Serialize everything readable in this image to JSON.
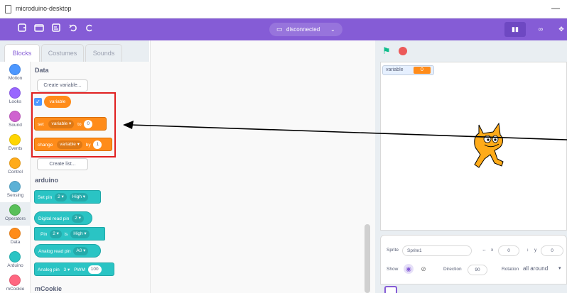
{
  "window": {
    "title": "microduino-desktop",
    "minimize": "—"
  },
  "menubar": {
    "connection_label": "disconnected",
    "mode_buttons": [
      "▮▮",
      "∞",
      "✥"
    ]
  },
  "tabs": [
    "Blocks",
    "Costumes",
    "Sounds"
  ],
  "categories": [
    {
      "label": "Motion",
      "color": "#4c97ff"
    },
    {
      "label": "Looks",
      "color": "#9966ff"
    },
    {
      "label": "Sound",
      "color": "#cf63cf"
    },
    {
      "label": "Events",
      "color": "#ffd500"
    },
    {
      "label": "Control",
      "color": "#ffab19"
    },
    {
      "label": "Sensing",
      "color": "#5cb1d6"
    },
    {
      "label": "Operators",
      "color": "#59c059"
    },
    {
      "label": "Data",
      "color": "#ff8c1a"
    },
    {
      "label": "Arduino",
      "color": "#2ac4c4"
    },
    {
      "label": "mCookie",
      "color": "#ff6680"
    }
  ],
  "palette": {
    "data_title": "Data",
    "create_variable": "Create variable...",
    "variable_reporter": "variable",
    "set_block": {
      "op": "set",
      "var": "variable",
      "to": "to",
      "value": "0"
    },
    "change_block": {
      "op": "change",
      "var": "variable",
      "by": "by",
      "value": "1"
    },
    "create_list": "Create list...",
    "arduino_title": "arduino",
    "set_pin": {
      "label": "Set pin",
      "pin": "2",
      "state": "High"
    },
    "digital_read": {
      "label": "Digital read pin",
      "pin": "2"
    },
    "pin_is": {
      "pin_word": "Pin",
      "pin": "2",
      "is": "is",
      "state": "High"
    },
    "analog_read": {
      "label": "Analog read pin",
      "pin": "A0"
    },
    "analog_pin": {
      "label": "Analog pin",
      "pin": "3",
      "pwm": "PWM",
      "value": "100"
    },
    "mcookie_title": "mCookie"
  },
  "stage": {
    "monitor_label": "variable",
    "monitor_value": "0"
  },
  "sprite_info": {
    "sprite_label": "Sprite",
    "sprite_name": "Sprite1",
    "x_label": "x",
    "x_value": "0",
    "y_label": "y",
    "y_value": "0",
    "show_label": "Show",
    "direction_label": "Direction",
    "direction_value": "90",
    "rotation_label": "Rotation",
    "rotation_value": "all around"
  },
  "colors": {
    "accent": "#855cd6",
    "data_orange": "#ff8c1a",
    "arduino_teal": "#2ac4c4",
    "highlight": "#e02020"
  }
}
